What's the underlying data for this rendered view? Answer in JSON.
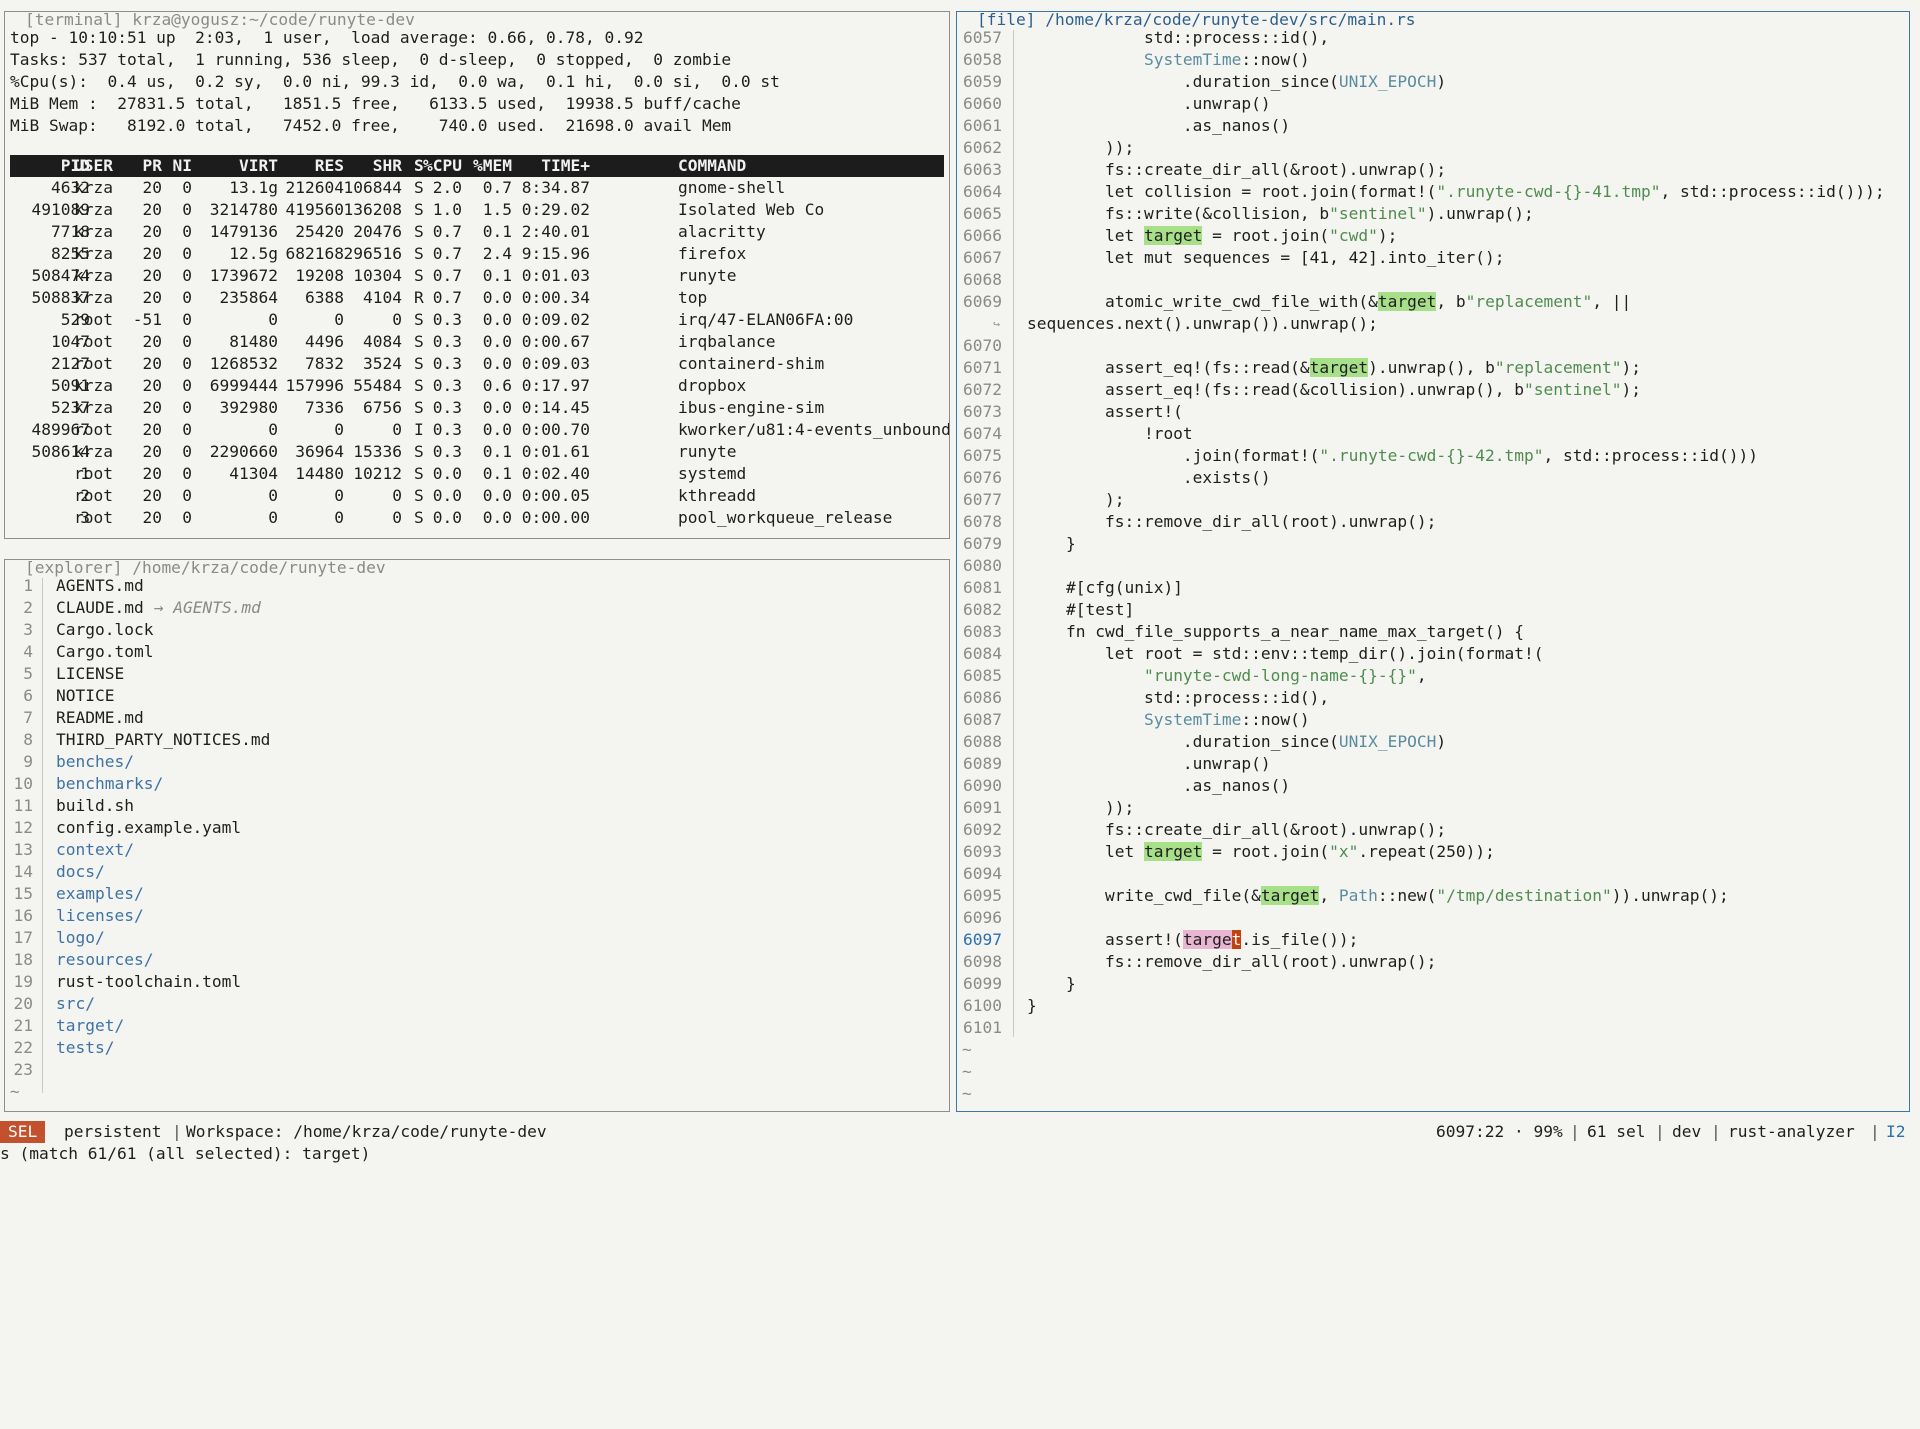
{
  "terminal": {
    "title": "[terminal] krza@yogusz:~/code/runyte-dev",
    "summary": [
      "top - 10:10:51 up  2:03,  1 user,  load average: 0.66, 0.78, 0.92",
      "Tasks: 537 total,  1 running, 536 sleep,  0 d-sleep,  0 stopped,  0 zombie",
      "%Cpu(s):  0.4 us,  0.2 sy,  0.0 ni, 99.3 id,  0.0 wa,  0.1 hi,  0.0 si,  0.0 st",
      "MiB Mem :  27831.5 total,   1851.5 free,   6133.5 used,  19938.5 buff/cache",
      "MiB Swap:   8192.0 total,   7452.0 free,    740.0 used.  21698.0 avail Mem"
    ],
    "columns": [
      "PID",
      "USER",
      "PR",
      "NI",
      "VIRT",
      "RES",
      "SHR",
      "S",
      "%CPU",
      "%MEM",
      "TIME+",
      "COMMAND"
    ],
    "rows": [
      [
        "4632",
        "krza",
        "20",
        "0",
        "13.1g",
        "212604",
        "106844",
        "S",
        "2.0",
        "0.7",
        "8:34.87",
        "gnome-shell"
      ],
      [
        "491089",
        "krza",
        "20",
        "0",
        "3214780",
        "419560",
        "136208",
        "S",
        "1.0",
        "1.5",
        "0:29.02",
        "Isolated Web Co"
      ],
      [
        "7718",
        "krza",
        "20",
        "0",
        "1479136",
        "25420",
        "20476",
        "S",
        "0.7",
        "0.1",
        "2:40.01",
        "alacritty"
      ],
      [
        "8255",
        "krza",
        "20",
        "0",
        "12.5g",
        "682168",
        "296516",
        "S",
        "0.7",
        "2.4",
        "9:15.96",
        "firefox"
      ],
      [
        "508474",
        "krza",
        "20",
        "0",
        "1739672",
        "19208",
        "10304",
        "S",
        "0.7",
        "0.1",
        "0:01.03",
        "runyte"
      ],
      [
        "508837",
        "krza",
        "20",
        "0",
        "235864",
        "6388",
        "4104",
        "R",
        "0.7",
        "0.0",
        "0:00.34",
        "top"
      ],
      [
        "529",
        "root",
        "-51",
        "0",
        "0",
        "0",
        "0",
        "S",
        "0.3",
        "0.0",
        "0:09.02",
        "irq/47-ELAN06FA:00"
      ],
      [
        "1047",
        "root",
        "20",
        "0",
        "81480",
        "4496",
        "4084",
        "S",
        "0.3",
        "0.0",
        "0:00.67",
        "irqbalance"
      ],
      [
        "2127",
        "root",
        "20",
        "0",
        "1268532",
        "7832",
        "3524",
        "S",
        "0.3",
        "0.0",
        "0:09.03",
        "containerd-shim"
      ],
      [
        "5091",
        "krza",
        "20",
        "0",
        "6999444",
        "157996",
        "55484",
        "S",
        "0.3",
        "0.6",
        "0:17.97",
        "dropbox"
      ],
      [
        "5237",
        "krza",
        "20",
        "0",
        "392980",
        "7336",
        "6756",
        "S",
        "0.3",
        "0.0",
        "0:14.45",
        "ibus-engine-sim"
      ],
      [
        "489967",
        "root",
        "20",
        "0",
        "0",
        "0",
        "0",
        "I",
        "0.3",
        "0.0",
        "0:00.70",
        "kworker/u81:4-events_unbound"
      ],
      [
        "508614",
        "krza",
        "20",
        "0",
        "2290660",
        "36964",
        "15336",
        "S",
        "0.3",
        "0.1",
        "0:01.61",
        "runyte"
      ],
      [
        "1",
        "root",
        "20",
        "0",
        "41304",
        "14480",
        "10212",
        "S",
        "0.0",
        "0.1",
        "0:02.40",
        "systemd"
      ],
      [
        "2",
        "root",
        "20",
        "0",
        "0",
        "0",
        "0",
        "S",
        "0.0",
        "0.0",
        "0:00.05",
        "kthreadd"
      ],
      [
        "3",
        "root",
        "20",
        "0",
        "0",
        "0",
        "0",
        "S",
        "0.0",
        "0.0",
        "0:00.00",
        "pool_workqueue_release"
      ]
    ]
  },
  "explorer": {
    "title": "[explorer] /home/krza/code/runyte-dev",
    "items": [
      {
        "n": "1",
        "name": "AGENTS.md",
        "dir": false
      },
      {
        "n": "2",
        "name": "CLAUDE.md",
        "dir": false,
        "link": "→ AGENTS.md"
      },
      {
        "n": "3",
        "name": "Cargo.lock",
        "dir": false
      },
      {
        "n": "4",
        "name": "Cargo.toml",
        "dir": false
      },
      {
        "n": "5",
        "name": "LICENSE",
        "dir": false
      },
      {
        "n": "6",
        "name": "NOTICE",
        "dir": false
      },
      {
        "n": "7",
        "name": "README.md",
        "dir": false
      },
      {
        "n": "8",
        "name": "THIRD_PARTY_NOTICES.md",
        "dir": false
      },
      {
        "n": "9",
        "name": "benches/",
        "dir": true
      },
      {
        "n": "10",
        "name": "benchmarks/",
        "dir": true
      },
      {
        "n": "11",
        "name": "build.sh",
        "dir": false
      },
      {
        "n": "12",
        "name": "config.example.yaml",
        "dir": false
      },
      {
        "n": "13",
        "name": "context/",
        "dir": true
      },
      {
        "n": "14",
        "name": "docs/",
        "dir": true
      },
      {
        "n": "15",
        "name": "examples/",
        "dir": true
      },
      {
        "n": "16",
        "name": "licenses/",
        "dir": true
      },
      {
        "n": "17",
        "name": "logo/",
        "dir": true
      },
      {
        "n": "18",
        "name": "resources/",
        "dir": true
      },
      {
        "n": "19",
        "name": "rust-toolchain.toml",
        "dir": false
      },
      {
        "n": "20",
        "name": "src/",
        "dir": true
      },
      {
        "n": "21",
        "name": "target/",
        "dir": true
      },
      {
        "n": "22",
        "name": "tests/",
        "dir": true
      },
      {
        "n": "23",
        "name": "",
        "dir": false
      }
    ],
    "tilde": "~"
  },
  "editor": {
    "title": "[file] /home/krza/code/runyte-dev/src/main.rs",
    "wrap_marker": "↪",
    "current_line": "6097",
    "lines": [
      {
        "n": "6057",
        "t": "            std::process::id(),"
      },
      {
        "n": "6058",
        "t": "            SystemTime::now()"
      },
      {
        "n": "6059",
        "t": "                .duration_since(UNIX_EPOCH)"
      },
      {
        "n": "6060",
        "t": "                .unwrap()"
      },
      {
        "n": "6061",
        "t": "                .as_nanos()"
      },
      {
        "n": "6062",
        "t": "        ));"
      },
      {
        "n": "6063",
        "t": "        fs::create_dir_all(&root).unwrap();"
      },
      {
        "n": "6064",
        "t": "        let collision = root.join(format!(\".runyte-cwd-{}-41.tmp\", std::process::id()));"
      },
      {
        "n": "6065",
        "t": "        fs::write(&collision, b\"sentinel\").unwrap();"
      },
      {
        "n": "6066",
        "t": "        let target = root.join(\"cwd\");"
      },
      {
        "n": "6067",
        "t": "        let mut sequences = [41, 42].into_iter();"
      },
      {
        "n": "6068",
        "t": ""
      },
      {
        "n": "6069",
        "t": "        atomic_write_cwd_file_with(&target, b\"replacement\", ||"
      },
      {
        "n": "",
        "t": "sequences.next().unwrap()).unwrap();",
        "wrap": true
      },
      {
        "n": "6070",
        "t": ""
      },
      {
        "n": "6071",
        "t": "        assert_eq!(fs::read(&target).unwrap(), b\"replacement\");"
      },
      {
        "n": "6072",
        "t": "        assert_eq!(fs::read(&collision).unwrap(), b\"sentinel\");"
      },
      {
        "n": "6073",
        "t": "        assert!("
      },
      {
        "n": "6074",
        "t": "            !root"
      },
      {
        "n": "6075",
        "t": "                .join(format!(\".runyte-cwd-{}-42.tmp\", std::process::id()))"
      },
      {
        "n": "6076",
        "t": "                .exists()"
      },
      {
        "n": "6077",
        "t": "        );"
      },
      {
        "n": "6078",
        "t": "        fs::remove_dir_all(root).unwrap();"
      },
      {
        "n": "6079",
        "t": "    }"
      },
      {
        "n": "6080",
        "t": ""
      },
      {
        "n": "6081",
        "t": "    #[cfg(unix)]"
      },
      {
        "n": "6082",
        "t": "    #[test]"
      },
      {
        "n": "6083",
        "t": "    fn cwd_file_supports_a_near_name_max_target() {"
      },
      {
        "n": "6084",
        "t": "        let root = std::env::temp_dir().join(format!("
      },
      {
        "n": "6085",
        "t": "            \"runyte-cwd-long-name-{}-{}\","
      },
      {
        "n": "6086",
        "t": "            std::process::id(),"
      },
      {
        "n": "6087",
        "t": "            SystemTime::now()"
      },
      {
        "n": "6088",
        "t": "                .duration_since(UNIX_EPOCH)"
      },
      {
        "n": "6089",
        "t": "                .unwrap()"
      },
      {
        "n": "6090",
        "t": "                .as_nanos()"
      },
      {
        "n": "6091",
        "t": "        ));"
      },
      {
        "n": "6092",
        "t": "        fs::create_dir_all(&root).unwrap();"
      },
      {
        "n": "6093",
        "t": "        let target = root.join(\"x\".repeat(250));"
      },
      {
        "n": "6094",
        "t": ""
      },
      {
        "n": "6095",
        "t": "        write_cwd_file(&target, Path::new(\"/tmp/destination\")).unwrap();"
      },
      {
        "n": "6096",
        "t": ""
      },
      {
        "n": "6097",
        "t": "        assert!(target.is_file());"
      },
      {
        "n": "6098",
        "t": "        fs::remove_dir_all(root).unwrap();"
      },
      {
        "n": "6099",
        "t": "    }"
      },
      {
        "n": "6100",
        "t": "}"
      },
      {
        "n": "6101",
        "t": ""
      }
    ],
    "tildes": [
      "~",
      "~",
      "~"
    ]
  },
  "statusbar": {
    "mode": "SEL",
    "session": "persistent",
    "workspace": "Workspace: /home/krza/code/runyte-dev",
    "position": "6097:22 · 99%",
    "selection": "61 sel",
    "branch": "dev",
    "lsp": "rust-analyzer",
    "indicator": "I2",
    "separator": "|",
    "message": "s (match 61/61 (all selected): target)"
  },
  "colors": {
    "accent": "#3f75a8",
    "selection": "#a8e08a",
    "primary_selection": "#e8b6d2",
    "cursor": "#c2410c",
    "mode_bg": "#c2522e"
  }
}
